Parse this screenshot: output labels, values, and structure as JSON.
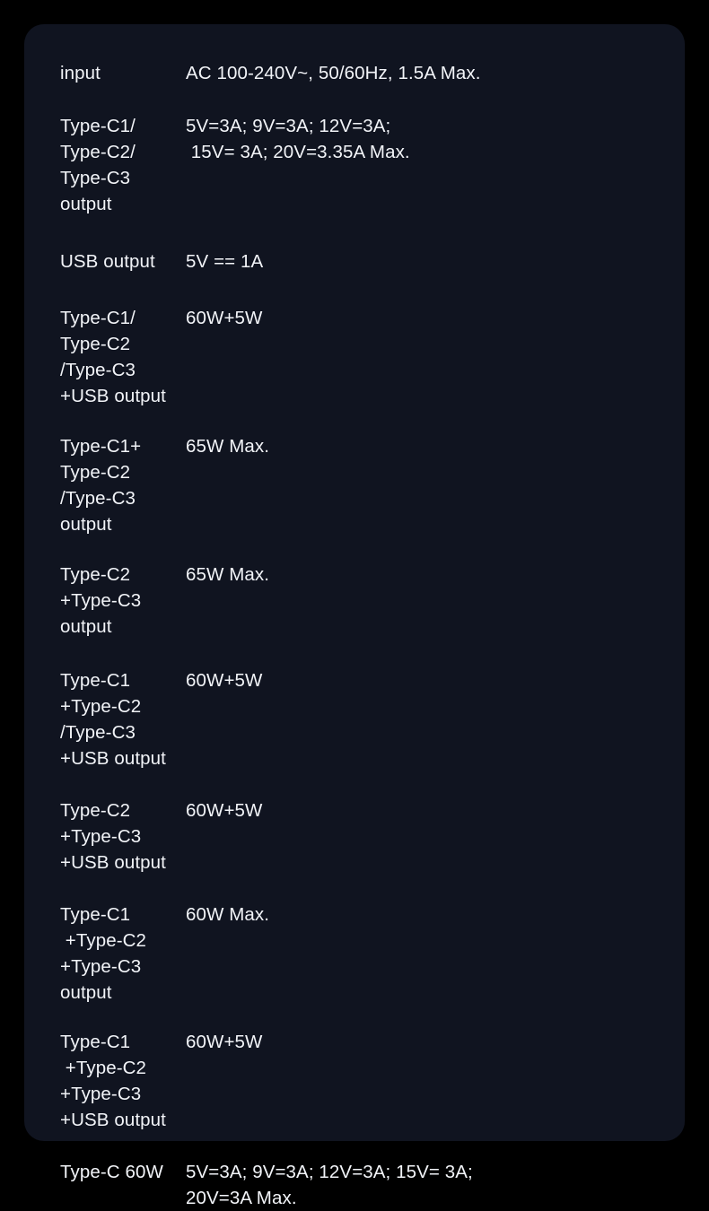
{
  "card": {
    "background_color": "#101420",
    "page_background_color": "#000000",
    "text_color": "#f2f4f8",
    "corner_radius": "22px"
  },
  "spec_table": {
    "rows": [
      {
        "label": "input",
        "value": "AC 100-240V~, 50/60Hz, 1.5A Max."
      },
      {
        "label": "Type-C1/\nType-C2/\nType-C3 output",
        "value": "5V=3A; 9V=3A; 12V=3A;\n 15V= 3A; 20V=3.35A Max."
      },
      {
        "label": "USB output",
        "value": "5V == 1A"
      },
      {
        "label": "Type-C1/\nType-C2\n/Type-C3\n+USB output",
        "value": "60W+5W"
      },
      {
        "label": "Type-C1+\nType-C2\n/Type-C3 output",
        "value": "65W Max."
      },
      {
        "label": "Type-C2\n+Type-C3 output",
        "value": "65W Max."
      },
      {
        "label": "Type-C1\n+Type-C2\n/Type-C3\n+USB output",
        "value": "60W+5W"
      },
      {
        "label": "Type-C2\n+Type-C3\n+USB output",
        "value": "60W+5W"
      },
      {
        "label": "Type-C1\n +Type-C2\n+Type-C3 output",
        "value": "60W Max."
      },
      {
        "label": "Type-C1\n +Type-C2\n+Type-C3\n+USB output",
        "value": "60W+5W"
      },
      {
        "label": "Type-C 60W",
        "value": "5V=3A; 9V=3A; 12V=3A; 15V= 3A;\n20V=3A Max."
      }
    ]
  }
}
